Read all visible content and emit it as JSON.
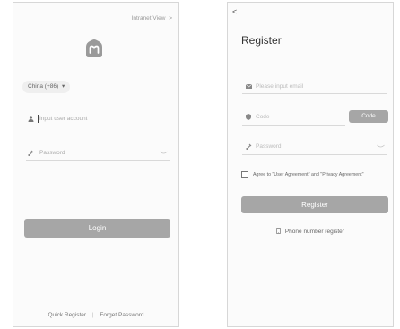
{
  "login": {
    "intranet_link": "Intranet View",
    "intranet_chevron": ">",
    "country_code": "China (+86)",
    "country_caret": "▾",
    "account_placeholder": "Input user account",
    "password_placeholder": "Password",
    "login_label": "Login",
    "quick_register": "Quick Register",
    "separator": "|",
    "forget_password": "Forget Password"
  },
  "register": {
    "back": "<",
    "title": "Register",
    "email_placeholder": "Please input email",
    "code_placeholder": "Code",
    "code_button": "Code",
    "password_placeholder": "Password",
    "agreement_text": "Agree to \"User Agreement\" and \"Privacy Agreement\"",
    "register_label": "Register",
    "phone_register": "Phone number register"
  },
  "colors": {
    "button": "#a6a6a6",
    "border": "#d7d7d7",
    "panel_bg": "#fbfbfb"
  },
  "icons": [
    "logo-icon",
    "user-icon",
    "lock-icon",
    "eye-icon",
    "mail-icon",
    "shield-icon",
    "phone-icon"
  ]
}
